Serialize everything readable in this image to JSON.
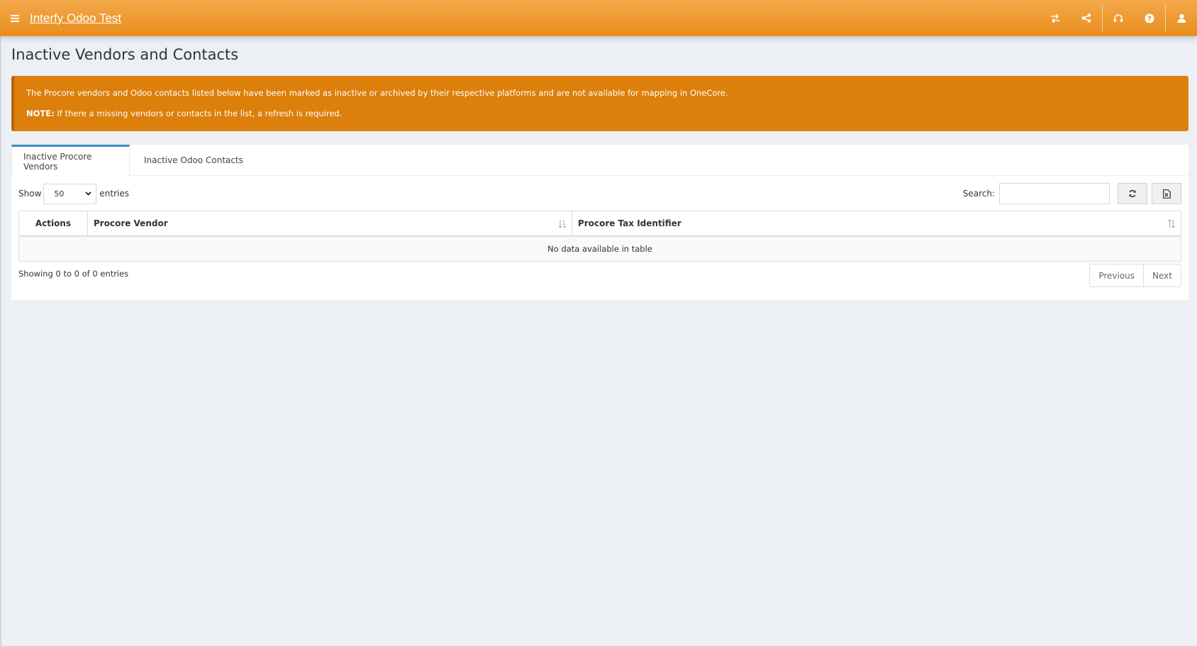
{
  "header": {
    "app_title": "Interfy Odoo Test",
    "icons": [
      "menu-icon",
      "transfer-icon",
      "share-icon",
      "headset-icon",
      "help-icon",
      "user-icon"
    ]
  },
  "page": {
    "title": "Inactive Vendors and Contacts"
  },
  "alert": {
    "message": "The Procore vendors and Odoo contacts listed below have been marked as inactive or archived by their respective platforms and are not available for mapping in OneCore.",
    "note_label": "NOTE:",
    "note_text": " If there a missing vendors or contacts in the list, a refresh is required.",
    "color": "#dc7f0b"
  },
  "tabs": [
    {
      "label": "Inactive Procore Vendors",
      "active": true
    },
    {
      "label": "Inactive Odoo Contacts",
      "active": false
    }
  ],
  "controls": {
    "show_label": "Show",
    "page_size": "50",
    "entries_label": "entries",
    "search_label": "Search:",
    "search_value": ""
  },
  "table": {
    "columns": [
      "Actions",
      "Procore Vendor",
      "Procore Tax Identifier"
    ],
    "empty_message": "No data available in table"
  },
  "footer": {
    "info": "Showing 0 to 0 of 0 entries",
    "previous_label": "Previous",
    "next_label": "Next"
  },
  "colors": {
    "header": "#e88d1c",
    "tab_accent": "#3c8dbc"
  }
}
